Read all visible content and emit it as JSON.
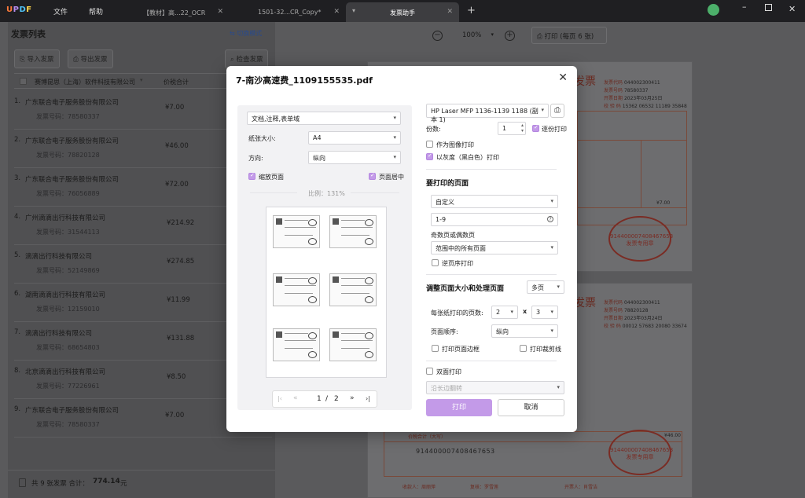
{
  "app": {
    "logo": "UPDF",
    "menu": [
      "文件",
      "帮助"
    ]
  },
  "tabs": [
    {
      "label": "【教材】高...22_OCR"
    },
    {
      "label": "1501-32...CR_Copy*"
    },
    {
      "label": "发票助手"
    }
  ],
  "left": {
    "title": "发票列表",
    "mode_label": "切换模式",
    "import_label": "导入发票",
    "export_label": "导出发票",
    "check_label": "检查发票",
    "col_seller": "赛博昆思（上海）软件科技有限公司",
    "col_amount": "价税合计",
    "rows": [
      {
        "name": "广东联合电子服务股份有限公司",
        "num": "发票号码：78580337",
        "amount": "¥7.00"
      },
      {
        "name": "广东联合电子服务股份有限公司",
        "num": "发票号码：78820128",
        "amount": "¥46.00"
      },
      {
        "name": "广东联合电子服务股份有限公司",
        "num": "发票号码：76056889",
        "amount": "¥72.00"
      },
      {
        "name": "广州滴滴出行科技有限公司",
        "num": "发票号码：31544113",
        "amount": "¥214.92"
      },
      {
        "name": "滴滴出行科技有限公司",
        "num": "发票号码：52149869",
        "amount": "¥274.85"
      },
      {
        "name": "湖南滴滴出行科技有限公司",
        "num": "发票号码：12159010",
        "amount": "¥11.99"
      },
      {
        "name": "滴滴出行科技有限公司",
        "num": "发票号码：68654803",
        "amount": "¥131.88"
      },
      {
        "name": "北京滴滴出行科技有限公司",
        "num": "发票号码：77226961",
        "amount": "¥8.50"
      },
      {
        "name": "广东联合电子服务股份有限公司",
        "num": "发票号码：78580337",
        "amount": "¥7.00"
      }
    ],
    "footer_count": "共 9 张发票 合计：",
    "footer_total": "774.14",
    "footer_unit": "元"
  },
  "toolbar": {
    "zoom": "100%",
    "print_label": "打印 (每页 6 张)"
  },
  "doc": {
    "title": "发票",
    "fields": [
      "发票代码",
      "发票号码",
      "开票日期",
      "校 验 码"
    ],
    "top_values": [
      "044002300411",
      "78580337",
      "2023年03月25日",
      "15362 06532 11189 35848"
    ],
    "bottom_values": [
      "044002300411",
      "78820128",
      "2023年03月24日",
      "00012 57683 20080 33674"
    ],
    "stamp_text": "发票专用章",
    "stamp_number": "914400007408467653",
    "amounts": [
      "¥7.00",
      "¥46.00"
    ],
    "total_label": "价税合计（大写）",
    "bottom_payee": "收款人：周丽萍",
    "bottom_review": "复核：罗雪莲",
    "bottom_issuer": "开票人：肖雪洁",
    "seller_id": "914400007408467653"
  },
  "modal": {
    "title": "7-南沙高速费_1109155535.pdf",
    "content_select": "文档,注释,表单域",
    "paper_label": "纸张大小:",
    "paper_value": "A4",
    "orient_label": "方向:",
    "orient_value": "纵向",
    "fit_label": "缩放页面",
    "center_label": "页面居中",
    "scale_label": "比例：131%",
    "page_current": "1",
    "page_sep": "/",
    "page_total": "2",
    "printer": "HP Laser MFP 1136-1139 1188 (副本 1)",
    "copies_label": "份数:",
    "copies_value": "1",
    "collate_label": "逐份打印",
    "as_image_label": "作为图像打印",
    "gray_label": "以灰度（黑白色）打印",
    "pages_section": "要打印的页面",
    "range_mode": "自定义",
    "range_value": "1-9",
    "oddeven_label": "奇数页或偶数页",
    "oddeven_value": "范围中的所有页面",
    "reverse_label": "逆页序打印",
    "resize_section": "调整页面大小和处理页面",
    "resize_mode": "多页",
    "per_sheet_label": "每张纸打印的页数:",
    "per_sheet_x": "2",
    "per_sheet_times": "x",
    "per_sheet_y": "3",
    "order_label": "页面顺序:",
    "order_value": "纵向",
    "border_label": "打印页面边框",
    "cutmark_label": "打印裁剪线",
    "duplex_label": "双面打印",
    "duplex_value": "沿长边翻转",
    "print_button": "打印",
    "cancel_button": "取消"
  },
  "colors": {
    "accent": "#c39ae8",
    "titlebar": "#1f1f22",
    "overlay": "#5a5a5c"
  }
}
